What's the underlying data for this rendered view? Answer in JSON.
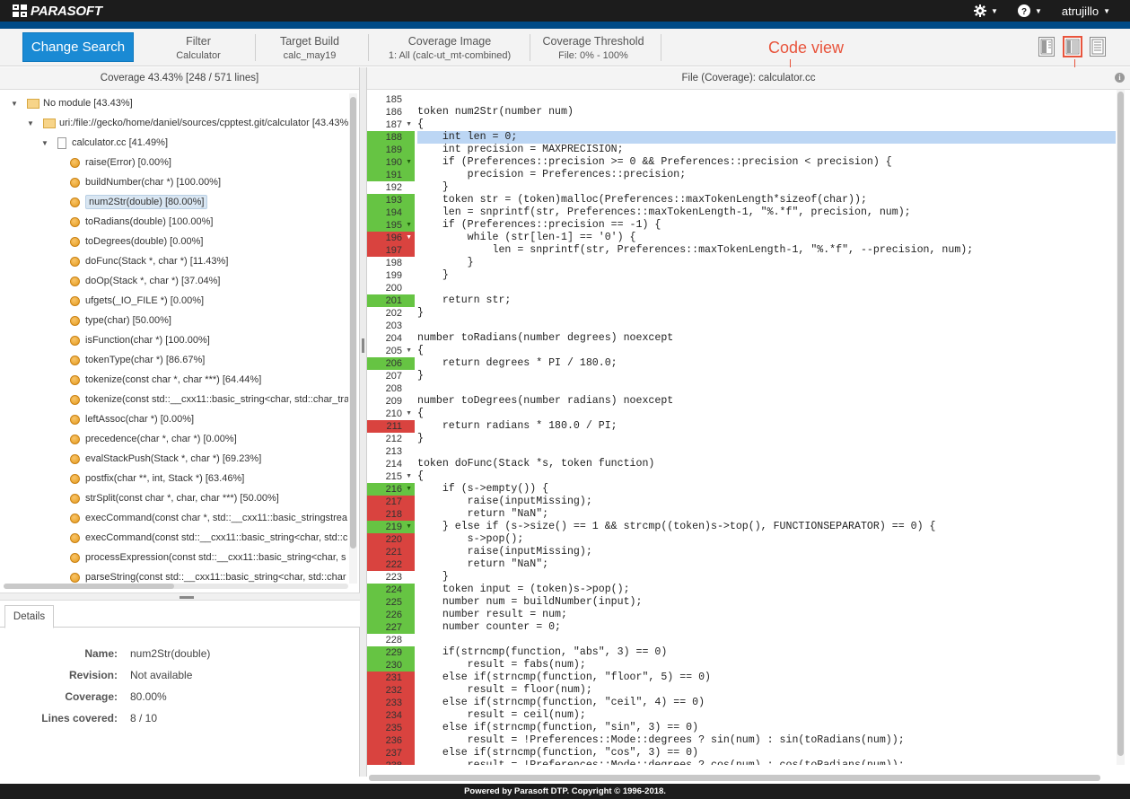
{
  "app": {
    "brand": "PARASOFT",
    "user": "atrujillo"
  },
  "toolbar": {
    "change_search": "Change Search",
    "filter": {
      "label": "Filter",
      "value": "Calculator"
    },
    "target_build": {
      "label": "Target Build",
      "value": "calc_may19"
    },
    "coverage_image": {
      "label": "Coverage Image",
      "value": "1: All (calc-ut_mt-combined)"
    },
    "coverage_threshold": {
      "label": "Coverage Threshold",
      "value": "File: 0% - 100%"
    },
    "callout": "Code view"
  },
  "left": {
    "header": "Coverage 43.43% [248 / 571 lines]",
    "tree": [
      {
        "kind": "folder",
        "level": 0,
        "label": "No module [43.43%]"
      },
      {
        "kind": "folder",
        "level": 1,
        "label": "uri:/file://gecko/home/daniel/sources/cpptest.git/calculator [43.43%"
      },
      {
        "kind": "file",
        "level": 2,
        "label": "calculator.cc [41.49%]"
      },
      {
        "kind": "fn",
        "label": "raise(Error) [0.00%]"
      },
      {
        "kind": "fn",
        "label": "buildNumber(char *) [100.00%]"
      },
      {
        "kind": "fn",
        "label": "num2Str(double) [80.00%]",
        "selected": true
      },
      {
        "kind": "fn",
        "label": "toRadians(double) [100.00%]"
      },
      {
        "kind": "fn",
        "label": "toDegrees(double) [0.00%]"
      },
      {
        "kind": "fn",
        "label": "doFunc(Stack *, char *) [11.43%]"
      },
      {
        "kind": "fn",
        "label": "doOp(Stack *, char *) [37.04%]"
      },
      {
        "kind": "fn",
        "label": "ufgets(_IO_FILE *) [0.00%]"
      },
      {
        "kind": "fn",
        "label": "type(char) [50.00%]"
      },
      {
        "kind": "fn",
        "label": "isFunction(char *) [100.00%]"
      },
      {
        "kind": "fn",
        "label": "tokenType(char *) [86.67%]"
      },
      {
        "kind": "fn",
        "label": "tokenize(const char *, char ***) [64.44%]"
      },
      {
        "kind": "fn",
        "label": "tokenize(const std::__cxx11::basic_string<char, std::char_tra"
      },
      {
        "kind": "fn",
        "label": "leftAssoc(char *) [0.00%]"
      },
      {
        "kind": "fn",
        "label": "precedence(char *, char *) [0.00%]"
      },
      {
        "kind": "fn",
        "label": "evalStackPush(Stack *, char *) [69.23%]"
      },
      {
        "kind": "fn",
        "label": "postfix(char **, int, Stack *) [63.46%]"
      },
      {
        "kind": "fn",
        "label": "strSplit(const char *, char, char ***) [50.00%]"
      },
      {
        "kind": "fn",
        "label": "execCommand(const char *, std::__cxx11::basic_stringstrea"
      },
      {
        "kind": "fn",
        "label": "execCommand(const std::__cxx11::basic_string<char, std::c"
      },
      {
        "kind": "fn",
        "label": "processExpression(const std::__cxx11::basic_string<char, s"
      },
      {
        "kind": "fn",
        "label": "parseString(const std::__cxx11::basic_string<char, std::char"
      }
    ],
    "details_tab": "Details",
    "details": [
      {
        "label": "Name:",
        "value": "num2Str(double)"
      },
      {
        "label": "Revision:",
        "value": "Not available"
      },
      {
        "label": "Coverage:",
        "value": "80.00%"
      },
      {
        "label": "Lines covered:",
        "value": "8 / 10"
      }
    ]
  },
  "right": {
    "header": "File (Coverage): calculator.cc",
    "code": [
      {
        "n": "185",
        "s": "",
        "c": ""
      },
      {
        "n": "186",
        "s": "token num2Str(number num)",
        "c": ""
      },
      {
        "n": "187",
        "s": "{",
        "c": "",
        "f": true
      },
      {
        "n": "188",
        "s": "    int len = 0;",
        "c": "cov",
        "hl": true
      },
      {
        "n": "189",
        "s": "    int precision = MAXPRECISION;",
        "c": "cov"
      },
      {
        "n": "190",
        "s": "    if (Preferences::precision >= 0 && Preferences::precision < precision) {",
        "c": "cov",
        "f": true
      },
      {
        "n": "191",
        "s": "        precision = Preferences::precision;",
        "c": "cov"
      },
      {
        "n": "192",
        "s": "    }",
        "c": ""
      },
      {
        "n": "193",
        "s": "    token str = (token)malloc(Preferences::maxTokenLength*sizeof(char));",
        "c": "cov"
      },
      {
        "n": "194",
        "s": "    len = snprintf(str, Preferences::maxTokenLength-1, \"%.*f\", precision, num);",
        "c": "cov"
      },
      {
        "n": "195",
        "s": "    if (Preferences::precision == -1) {",
        "c": "cov",
        "f": true
      },
      {
        "n": "196",
        "s": "        while (str[len-1] == '0') {",
        "c": "unc",
        "f": true
      },
      {
        "n": "197",
        "s": "            len = snprintf(str, Preferences::maxTokenLength-1, \"%.*f\", --precision, num);",
        "c": "unc"
      },
      {
        "n": "198",
        "s": "        }",
        "c": ""
      },
      {
        "n": "199",
        "s": "    }",
        "c": ""
      },
      {
        "n": "200",
        "s": "",
        "c": ""
      },
      {
        "n": "201",
        "s": "    return str;",
        "c": "cov"
      },
      {
        "n": "202",
        "s": "}",
        "c": ""
      },
      {
        "n": "203",
        "s": "",
        "c": ""
      },
      {
        "n": "204",
        "s": "number toRadians(number degrees) noexcept",
        "c": ""
      },
      {
        "n": "205",
        "s": "{",
        "c": "",
        "f": true
      },
      {
        "n": "206",
        "s": "    return degrees * PI / 180.0;",
        "c": "cov"
      },
      {
        "n": "207",
        "s": "}",
        "c": ""
      },
      {
        "n": "208",
        "s": "",
        "c": ""
      },
      {
        "n": "209",
        "s": "number toDegrees(number radians) noexcept",
        "c": ""
      },
      {
        "n": "210",
        "s": "{",
        "c": "",
        "f": true
      },
      {
        "n": "211",
        "s": "    return radians * 180.0 / PI;",
        "c": "unc"
      },
      {
        "n": "212",
        "s": "}",
        "c": ""
      },
      {
        "n": "213",
        "s": "",
        "c": ""
      },
      {
        "n": "214",
        "s": "token doFunc(Stack *s, token function)",
        "c": ""
      },
      {
        "n": "215",
        "s": "{",
        "c": "",
        "f": true
      },
      {
        "n": "216",
        "s": "    if (s->empty()) {",
        "c": "cov",
        "f": true
      },
      {
        "n": "217",
        "s": "        raise(inputMissing);",
        "c": "unc"
      },
      {
        "n": "218",
        "s": "        return \"NaN\";",
        "c": "unc"
      },
      {
        "n": "219",
        "s": "    } else if (s->size() == 1 && strcmp((token)s->top(), FUNCTIONSEPARATOR) == 0) {",
        "c": "cov",
        "f": true
      },
      {
        "n": "220",
        "s": "        s->pop();",
        "c": "unc"
      },
      {
        "n": "221",
        "s": "        raise(inputMissing);",
        "c": "unc"
      },
      {
        "n": "222",
        "s": "        return \"NaN\";",
        "c": "unc"
      },
      {
        "n": "223",
        "s": "    }",
        "c": ""
      },
      {
        "n": "224",
        "s": "    token input = (token)s->pop();",
        "c": "cov"
      },
      {
        "n": "225",
        "s": "    number num = buildNumber(input);",
        "c": "cov"
      },
      {
        "n": "226",
        "s": "    number result = num;",
        "c": "cov"
      },
      {
        "n": "227",
        "s": "    number counter = 0;",
        "c": "cov"
      },
      {
        "n": "228",
        "s": "",
        "c": ""
      },
      {
        "n": "229",
        "s": "    if(strncmp(function, \"abs\", 3) == 0)",
        "c": "cov"
      },
      {
        "n": "230",
        "s": "        result = fabs(num);",
        "c": "cov"
      },
      {
        "n": "231",
        "s": "    else if(strncmp(function, \"floor\", 5) == 0)",
        "c": "unc"
      },
      {
        "n": "232",
        "s": "        result = floor(num);",
        "c": "unc"
      },
      {
        "n": "233",
        "s": "    else if(strncmp(function, \"ceil\", 4) == 0)",
        "c": "unc"
      },
      {
        "n": "234",
        "s": "        result = ceil(num);",
        "c": "unc"
      },
      {
        "n": "235",
        "s": "    else if(strncmp(function, \"sin\", 3) == 0)",
        "c": "unc"
      },
      {
        "n": "236",
        "s": "        result = !Preferences::Mode::degrees ? sin(num) : sin(toRadians(num));",
        "c": "unc"
      },
      {
        "n": "237",
        "s": "    else if(strncmp(function, \"cos\", 3) == 0)",
        "c": "unc"
      },
      {
        "n": "238",
        "s": "        result = !Preferences::Mode::degrees ? cos(num) : cos(toRadians(num));",
        "c": "unc"
      },
      {
        "n": "239",
        "s": "",
        "c": "unc"
      }
    ]
  },
  "footer": "Powered by Parasoft DTP. Copyright © 1996-2018.",
  "colors": {
    "covered": "#66c443",
    "uncovered": "#d9433f",
    "accent": "#1a8ad4",
    "callout": "#e8543c",
    "highlight": "#bcd6f4"
  }
}
